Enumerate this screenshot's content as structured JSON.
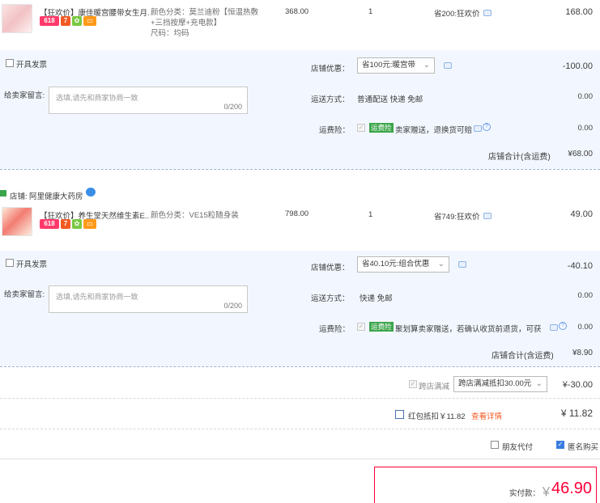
{
  "item1": {
    "title": "【狂欢价】康佳暖宫腰带女生月...",
    "sku_lines": [
      "颜色分类：莫兰迪粉【恒温热敷",
      "+三挡按摩+充电款】",
      "尺码：均码"
    ],
    "orig_price": "368.00",
    "qty": "1",
    "promo": "省200:狂欢价",
    "price": "168.00",
    "badge_618": "618",
    "badge_7": "7"
  },
  "shop1": {
    "invoice_label": "开具发票",
    "msg_label": "给卖家留言:",
    "msg_placeholder": "选填,请先和商家协商一致",
    "msg_count": "0/200",
    "coupon_label": "店铺优惠：",
    "coupon_value": "省100元:暖宫带",
    "coupon_amount": "-100.00",
    "ship_label": "运送方式：",
    "ship_value": "普通配送 快递 免邮",
    "ship_amount": "0.00",
    "ins_label": "运费险：",
    "ins_badge": "运费险",
    "ins_text": "卖家赠送，退换货可赔",
    "ins_amount": "0.00",
    "total_label": "店铺合计(含运费)",
    "total_value": "¥68.00"
  },
  "shop2_header": {
    "label": "店铺:",
    "name": "阿里健康大药房"
  },
  "item2": {
    "title": "【狂欢价】养生堂天然维生素E...",
    "sku_lines": [
      "颜色分类：VE15粒随身装"
    ],
    "orig_price": "798.00",
    "qty": "1",
    "promo": "省749:狂欢价",
    "price": "49.00",
    "badge_618": "618",
    "badge_7": "7"
  },
  "shop2": {
    "invoice_label": "开具发票",
    "msg_label": "给卖家留言:",
    "msg_placeholder": "选填,请先和商家协商一致",
    "msg_count": "0/200",
    "coupon_label": "店铺优惠：",
    "coupon_value": "省40.10元:组合优惠",
    "coupon_amount": "-40.10",
    "ship_label": "运送方式：",
    "ship_value": "快递 免邮",
    "ship_amount": "0.00",
    "ins_label": "运费险：",
    "ins_badge": "运费险",
    "ins_text": "聚划算卖家赠送，若确认收货前退货，可获...",
    "ins_amount": "0.00",
    "total_label": "店铺合计(含运费)",
    "total_value": "¥8.90"
  },
  "cross": {
    "label": "跨店满减",
    "select": "跨店满减抵扣30.00元",
    "amount": "¥-30.00"
  },
  "redpack": {
    "label": "红包抵扣￥11.82",
    "link": "查看详情",
    "amount": "¥ 11.82"
  },
  "options": {
    "friend": "朋友代付",
    "anon": "匿名购买"
  },
  "pay": {
    "label": "实付款：",
    "currency": "￥",
    "amount": "46.90"
  }
}
